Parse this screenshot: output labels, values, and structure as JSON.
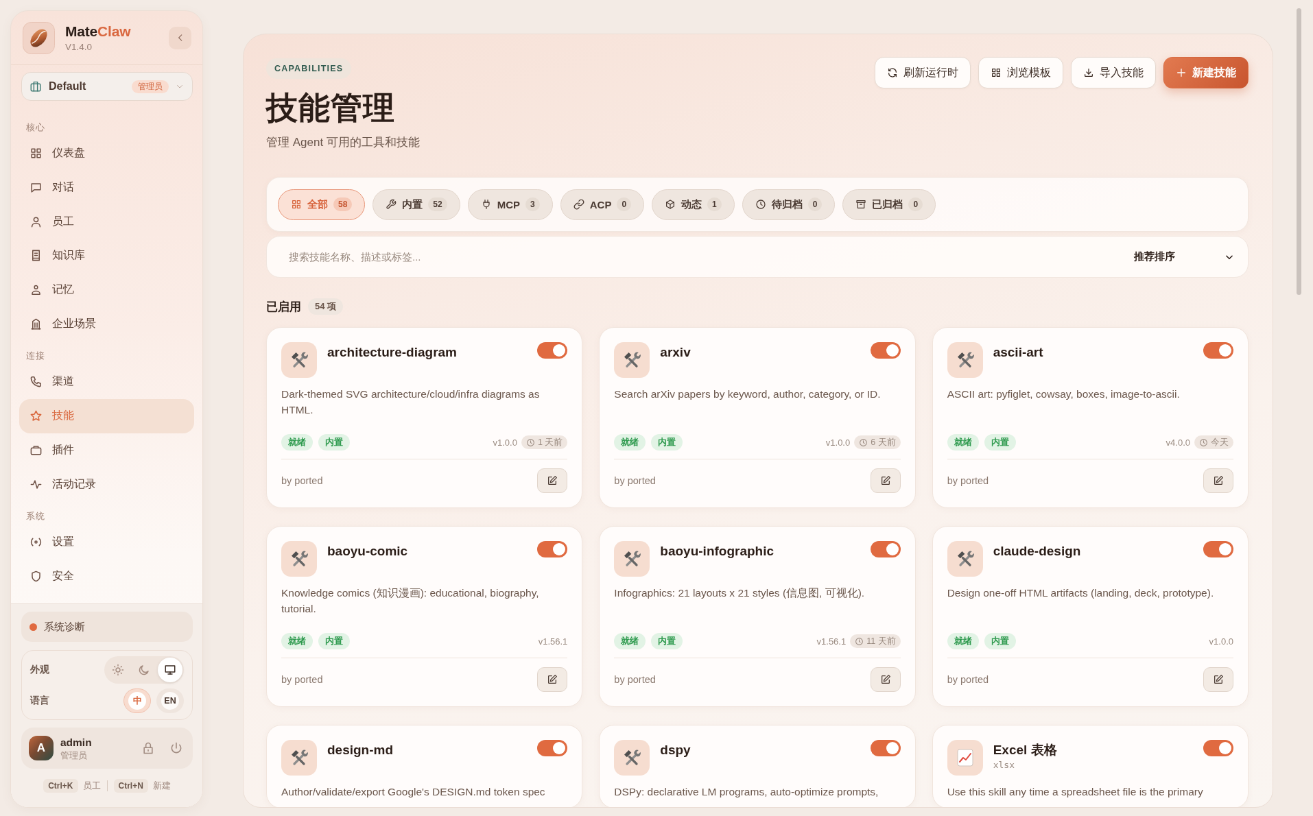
{
  "sidebar": {
    "brand": {
      "name": "Mate",
      "name_accent": "Claw",
      "version": "V1.4.0"
    },
    "workspace": {
      "name": "Default",
      "role": "管理员"
    },
    "sections": [
      {
        "label": "核心",
        "items": [
          {
            "label": "仪表盘",
            "selected": false
          },
          {
            "label": "对话",
            "selected": false
          },
          {
            "label": "员工",
            "selected": false
          },
          {
            "label": "知识库",
            "selected": false
          },
          {
            "label": "记忆",
            "selected": false
          },
          {
            "label": "企业场景",
            "selected": false
          }
        ]
      },
      {
        "label": "连接",
        "items": [
          {
            "label": "渠道",
            "selected": false
          },
          {
            "label": "技能",
            "selected": true
          },
          {
            "label": "插件",
            "selected": false
          },
          {
            "label": "活动记录",
            "selected": false
          }
        ]
      },
      {
        "label": "系统",
        "items": [
          {
            "label": "设置",
            "selected": false
          },
          {
            "label": "安全",
            "selected": false
          }
        ]
      }
    ],
    "diagnostics": "系统诊断",
    "appearance": {
      "label": "外观",
      "options": [
        {
          "selected": false
        },
        {
          "selected": false
        },
        {
          "selected": true
        }
      ]
    },
    "language": {
      "label": "语言",
      "options": [
        {
          "label": "中",
          "selected": true
        },
        {
          "label": "EN",
          "selected": false
        }
      ]
    },
    "user": {
      "initial": "A",
      "name": "admin",
      "role": "管理员"
    },
    "shortcuts": [
      {
        "keys": "Ctrl+K",
        "label": "员工"
      },
      {
        "keys": "Ctrl+N",
        "label": "新建"
      }
    ]
  },
  "header": {
    "eyebrow": "CAPABILITIES",
    "title": "技能管理",
    "subtitle": "管理 Agent 可用的工具和技能",
    "actions": [
      {
        "label": "刷新运行时",
        "kind": "secondary"
      },
      {
        "label": "浏览模板",
        "kind": "secondary"
      },
      {
        "label": "导入技能",
        "kind": "secondary"
      },
      {
        "label": "新建技能",
        "kind": "primary"
      }
    ]
  },
  "filter_tabs": [
    {
      "label": "全部",
      "count": "58",
      "selected": true
    },
    {
      "label": "内置",
      "count": "52",
      "selected": false
    },
    {
      "label": "MCP",
      "count": "3",
      "selected": false
    },
    {
      "label": "ACP",
      "count": "0",
      "selected": false
    },
    {
      "label": "动态",
      "count": "1",
      "selected": false
    },
    {
      "label": "待归档",
      "count": "0",
      "selected": false
    },
    {
      "label": "已归档",
      "count": "0",
      "selected": false
    }
  ],
  "search": {
    "placeholder": "搜索技能名称、描述或标签...",
    "sort": "推荐排序"
  },
  "section": {
    "title": "已启用",
    "count": "54 项"
  },
  "skills": [
    {
      "kind": "tool",
      "name": "architecture-diagram",
      "enabled": true,
      "description": "Dark-themed SVG architecture/cloud/infra diagrams as HTML.",
      "tags": [
        "就绪",
        "内置"
      ],
      "version": "v1.0.0",
      "updated": "1 天前",
      "author": "by ported"
    },
    {
      "kind": "tool",
      "name": "arxiv",
      "enabled": true,
      "description": "Search arXiv papers by keyword, author, category, or ID.",
      "tags": [
        "就绪",
        "内置"
      ],
      "version": "v1.0.0",
      "updated": "6 天前",
      "author": "by ported"
    },
    {
      "kind": "tool",
      "name": "ascii-art",
      "enabled": true,
      "description": "ASCII art: pyfiglet, cowsay, boxes, image-to-ascii.",
      "tags": [
        "就绪",
        "内置"
      ],
      "version": "v4.0.0",
      "updated": "今天",
      "author": "by ported"
    },
    {
      "kind": "tool",
      "name": "baoyu-comic",
      "enabled": true,
      "description": "Knowledge comics (知识漫画): educational, biography, tutorial.",
      "tags": [
        "就绪",
        "内置"
      ],
      "version": "v1.56.1",
      "author": "by ported"
    },
    {
      "kind": "tool",
      "name": "baoyu-infographic",
      "enabled": true,
      "description": "Infographics: 21 layouts x 21 styles (信息图, 可视化).",
      "tags": [
        "就绪",
        "内置"
      ],
      "version": "v1.56.1",
      "updated": "11 天前",
      "author": "by ported"
    },
    {
      "kind": "tool",
      "name": "claude-design",
      "enabled": true,
      "description": "Design one-off HTML artifacts (landing, deck, prototype).",
      "tags": [
        "就绪",
        "内置"
      ],
      "version": "v1.0.0",
      "author": "by ported"
    },
    {
      "kind": "tool",
      "name": "design-md",
      "enabled": true,
      "description": "Author/validate/export Google's DESIGN.md token spec"
    },
    {
      "kind": "tool",
      "name": "dspy",
      "enabled": true,
      "description": "DSPy: declarative LM programs, auto-optimize prompts,"
    },
    {
      "kind": "chart",
      "name": "Excel 表格",
      "subtitle": "xlsx",
      "enabled": true,
      "description": "Use this skill any time a spreadsheet file is the primary"
    }
  ]
}
